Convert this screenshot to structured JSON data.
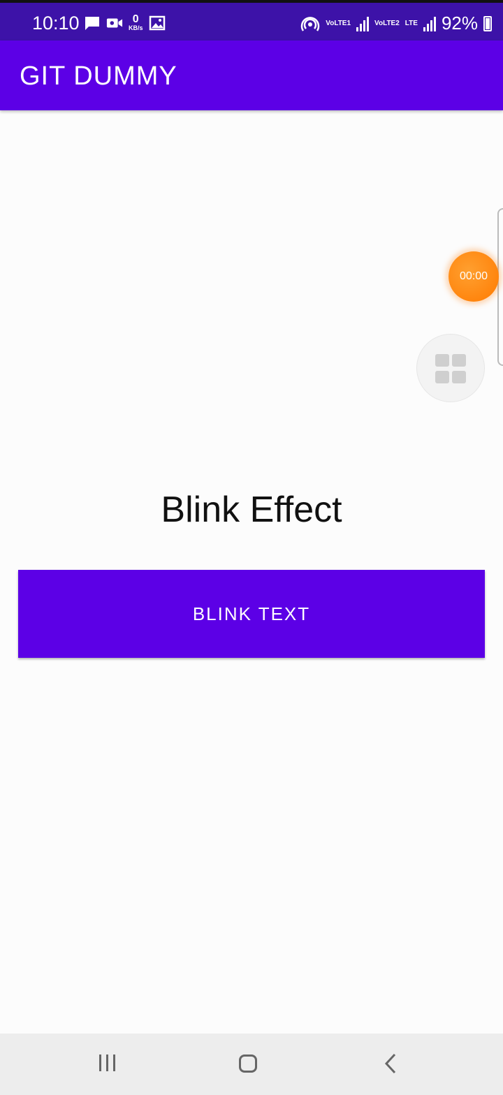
{
  "status_bar": {
    "time": "10:10",
    "net_speed_value": "0",
    "net_speed_unit": "KB/s",
    "sim1_label": "VoLTE1",
    "sim2_label": "VoLTE2",
    "lte_label": "LTE",
    "battery_percent": "92%",
    "icons": [
      "message-icon",
      "video-icon",
      "image-icon",
      "hotspot-icon",
      "signal-icon",
      "battery-icon"
    ]
  },
  "app_bar": {
    "title": "GIT DUMMY"
  },
  "overlay": {
    "recorder_time": "00:00"
  },
  "main": {
    "label": "Blink Effect",
    "button_label": "BLINK TEXT"
  },
  "colors": {
    "status_bar": "#3d12a8",
    "app_bar": "#5c00e6",
    "button": "#5c00e6",
    "recorder": "#ff7a00",
    "background": "#fcfcfc"
  },
  "nav_bar": {
    "icons": [
      "recents-icon",
      "home-icon",
      "back-icon"
    ]
  }
}
